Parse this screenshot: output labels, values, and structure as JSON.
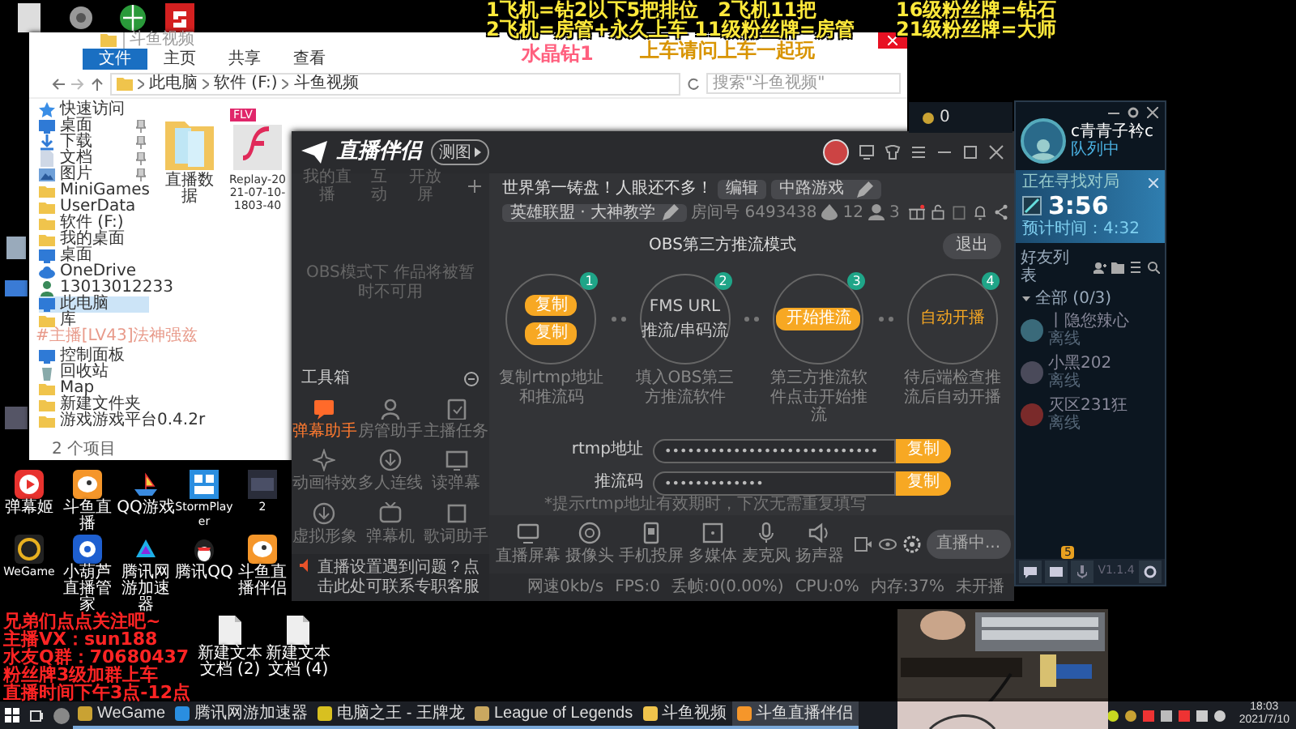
{
  "overlay": {
    "lines_left": [
      "1飞机=钻2以下5把排位　2飞机11把",
      "2飞机=房管+永久上车 11级粉丝牌=房管"
    ],
    "lines_right": [
      "16级粉丝牌=钻石",
      "21级粉丝牌=大师"
    ],
    "pink_note": "水晶钻1",
    "yellow_note": "上车请问上车一起玩",
    "chat_message": "#主播[LV43]法神强兹",
    "promo_lines": [
      "兄弟们点点关注吧~",
      "主播VX：sun188",
      "水友Q群：70680437",
      "粉丝牌3级加群上车",
      "直播时间下午3点-12点"
    ]
  },
  "desktop_icons": [
    {
      "label": "弹幕姬",
      "kind": "player"
    },
    {
      "label": "斗鱼直播",
      "kind": "mascot"
    },
    {
      "label": "QQ游戏",
      "kind": "boat"
    },
    {
      "label": "StormPlayer",
      "kind": "grid"
    },
    {
      "label": "2",
      "kind": "thumbnail"
    },
    {
      "label": "WeGame",
      "kind": "wegame"
    },
    {
      "label": "小葫芦直播管家",
      "kind": "remote"
    },
    {
      "label": "腾讯网游加速器",
      "kind": "accelerator"
    },
    {
      "label": "腾讯QQ",
      "kind": "penguin"
    },
    {
      "label": "斗鱼直播伴侣",
      "kind": "mascot"
    }
  ],
  "desktop_files": [
    {
      "label": "新建文本文档 (2)"
    },
    {
      "label": "新建文本文档 (4)"
    }
  ],
  "explorer": {
    "title": "斗鱼视频",
    "ribbon_tabs": [
      {
        "label": "文件",
        "selected": true
      },
      {
        "label": "主页",
        "selected": false
      },
      {
        "label": "共享",
        "selected": false
      },
      {
        "label": "查看",
        "selected": false
      }
    ],
    "breadcrumb": [
      "此电脑",
      "软件 (F:)",
      "斗鱼视频"
    ],
    "search": {
      "placeholder": "搜索\"斗鱼视频\""
    },
    "nav_upper": [
      {
        "label": "快速访问",
        "kind": "star",
        "pinned": false,
        "selected": false
      },
      {
        "label": "桌面",
        "kind": "desktop",
        "pinned": true,
        "selected": false
      },
      {
        "label": "下载",
        "kind": "download",
        "pinned": true,
        "selected": false
      },
      {
        "label": "文档",
        "kind": "doc",
        "pinned": true,
        "selected": false
      },
      {
        "label": "图片",
        "kind": "picture",
        "pinned": true,
        "selected": false
      },
      {
        "label": "MiniGames",
        "kind": "folder",
        "pinned": false,
        "selected": false
      },
      {
        "label": "UserData",
        "kind": "folder",
        "pinned": false,
        "selected": false
      },
      {
        "label": "软件 (F:)",
        "kind": "folder",
        "pinned": false,
        "selected": false
      },
      {
        "label": "我的桌面",
        "kind": "folder",
        "pinned": false,
        "selected": false
      },
      {
        "label": "桌面",
        "kind": "desktop",
        "pinned": false,
        "selected": false
      },
      {
        "label": "OneDrive",
        "kind": "cloud",
        "pinned": false,
        "selected": false
      },
      {
        "label": "13013012233",
        "kind": "user",
        "pinned": false,
        "selected": false
      },
      {
        "label": "此电脑",
        "kind": "desktop",
        "pinned": false,
        "selected": true
      },
      {
        "label": "库",
        "kind": "folder",
        "pinned": false,
        "selected": false
      }
    ],
    "nav_lower": [
      {
        "label": "控制面板",
        "kind": "desktop",
        "pinned": false,
        "selected": false
      },
      {
        "label": "回收站",
        "kind": "bin",
        "pinned": false,
        "selected": false
      },
      {
        "label": "Map",
        "kind": "folder",
        "pinned": false,
        "selected": false
      },
      {
        "label": "新建文件夹",
        "kind": "folder",
        "pinned": false,
        "selected": false
      },
      {
        "label": "游戏游戏平台0.4.2r",
        "kind": "folder",
        "pinned": false,
        "selected": false
      }
    ],
    "files": [
      {
        "name": "直播数据",
        "kind": "folder"
      },
      {
        "name": "Replay-2021-07-10-1803-40",
        "kind": "video",
        "badge": "FLV"
      }
    ],
    "status": "2 个项目"
  },
  "streamer": {
    "brand": "直播伴侣",
    "version_badge": "测图",
    "tabs": [
      "我的直播",
      "互动",
      "开放屏"
    ],
    "empty_text": "OBS模式下 作品将被暂时不可用",
    "toolbox_title": "工具箱",
    "tools": [
      {
        "label": "弹幕助手",
        "kind": "chat",
        "selected": true
      },
      {
        "label": "房管助手",
        "kind": "person",
        "selected": false
      },
      {
        "label": "主播任务",
        "kind": "clipboard",
        "selected": false
      },
      {
        "label": "动画特效",
        "kind": "sparkle",
        "selected": false
      },
      {
        "label": "多人连线",
        "kind": "download",
        "selected": false
      },
      {
        "label": "读弹幕",
        "kind": "monitor",
        "selected": false
      },
      {
        "label": "虚拟形象",
        "kind": "download",
        "selected": false
      },
      {
        "label": "弹幕机",
        "kind": "tv",
        "selected": false
      },
      {
        "label": "歌词助手",
        "kind": "square",
        "selected": false
      }
    ],
    "notice": "直播设置遇到问题？点击此处可联系专职客服",
    "title": "世界第一铸盘！人眼还不多！",
    "edit_label": "编辑",
    "category": "中路游戏",
    "game": "英雄联盟 · 大神教学",
    "room": "房间号 6493438",
    "likes": "12",
    "viewers": "3",
    "mode_title": "OBS第三方推流模式",
    "exit": "退出",
    "steps": [
      {
        "number": "1",
        "kind": "copy",
        "items": [
          "复制",
          "复制"
        ],
        "caption": "复制rtmp地址和推流码"
      },
      {
        "number": "2",
        "kind": "paste",
        "items": [
          "FMS URL",
          "推流/串码流"
        ],
        "caption": "填入OBS第三方推流软件"
      },
      {
        "number": "3",
        "kind": "start",
        "items": [
          "开始推流"
        ],
        "caption": "第三方推流软件点击开始推流"
      },
      {
        "number": "4",
        "kind": "auto",
        "items": [
          "自动开播"
        ],
        "caption": "待后端检查推流后自动开播"
      }
    ],
    "fields": [
      {
        "label": "rtmp地址",
        "value": "••••••••••••••••••••••••••••",
        "button": "复制"
      },
      {
        "label": "推流码",
        "value": "•••••••••••••",
        "button": "复制"
      }
    ],
    "hint": "*提示rtmp地址有效期时，下次无需重复填写",
    "bottom_tools": [
      {
        "label": "直播屏幕",
        "kind": "screen"
      },
      {
        "label": "摄像头",
        "kind": "camera"
      },
      {
        "label": "手机投屏",
        "kind": "phone"
      },
      {
        "label": "多媒体",
        "kind": "media"
      },
      {
        "label": "麦克风",
        "kind": "mic"
      },
      {
        "label": "扬声器",
        "kind": "speaker"
      }
    ],
    "live_button": "直播中...",
    "status": [
      "网速0kb/s",
      "FPS:0",
      "丢帧:0(0.00%)",
      "CPU:0%",
      "内存:37%",
      "未开播"
    ]
  },
  "client": {
    "coins": "0",
    "username": "c青青子衿c",
    "status": "队列中",
    "queue": {
      "title": "正在寻找对局",
      "timer": "3:56",
      "estimate": "预计时间：4:32"
    },
    "friends_title": "好友列表",
    "group": {
      "label": "全部 (0/3)",
      "expanded": true
    },
    "friends": [
      {
        "name": "丨隐您辣心",
        "status": "离线"
      },
      {
        "name": "小黑202",
        "status": "离线"
      },
      {
        "name": "灭区231狂",
        "status": "离线"
      }
    ],
    "notification_count": "5",
    "version": "V1.1.4"
  },
  "taskbar": {
    "items": [
      {
        "label": "WeGame",
        "selected": false
      },
      {
        "label": "腾讯网游加速器",
        "selected": false
      },
      {
        "label": "电脑之王 - 王牌龙",
        "selected": false
      },
      {
        "label": "League of Legends",
        "selected": false
      },
      {
        "label": "斗鱼视频",
        "selected": false
      },
      {
        "label": "斗鱼直播伴侣",
        "selected": true
      }
    ],
    "time": "18:03",
    "date": "2021/7/10"
  }
}
